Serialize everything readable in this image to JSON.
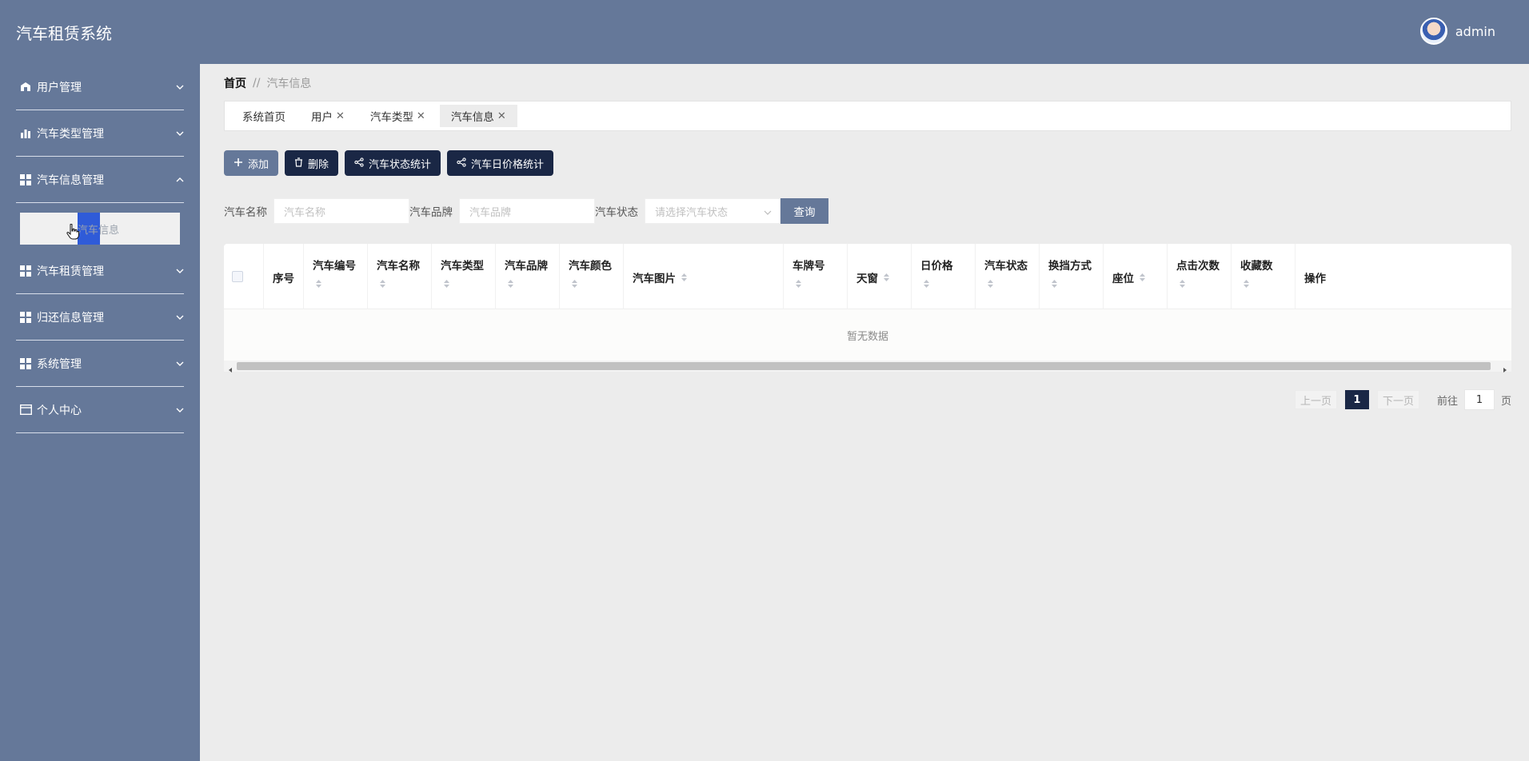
{
  "header": {
    "title": "汽车租赁系统",
    "username": "admin"
  },
  "sidebar": {
    "items": [
      {
        "label": "用户管理",
        "icon": "user-icon",
        "expanded": false
      },
      {
        "label": "汽车类型管理",
        "icon": "bar-chart-icon",
        "expanded": false
      },
      {
        "label": "汽车信息管理",
        "icon": "grid-icon",
        "expanded": true,
        "sub": [
          {
            "label": "汽车信息"
          }
        ]
      },
      {
        "label": "汽车租赁管理",
        "icon": "grid-icon",
        "expanded": false
      },
      {
        "label": "归还信息管理",
        "icon": "grid-icon",
        "expanded": false
      },
      {
        "label": "系统管理",
        "icon": "grid-icon",
        "expanded": false
      },
      {
        "label": "个人中心",
        "icon": "card-icon",
        "expanded": false
      }
    ]
  },
  "breadcrumb": {
    "home": "首页",
    "separator": "//",
    "current": "汽车信息"
  },
  "tabs": [
    {
      "label": "系统首页",
      "closable": false
    },
    {
      "label": "用户",
      "closable": true
    },
    {
      "label": "汽车类型",
      "closable": true
    },
    {
      "label": "汽车信息",
      "closable": true,
      "active": true
    }
  ],
  "actions": {
    "add": "添加",
    "delete": "删除",
    "status_stats": "汽车状态统计",
    "price_stats": "汽车日价格统计"
  },
  "filters": {
    "name_label": "汽车名称",
    "name_placeholder": "汽车名称",
    "brand_label": "汽车品牌",
    "brand_placeholder": "汽车品牌",
    "status_label": "汽车状态",
    "status_placeholder": "请选择汽车状态",
    "query": "查询"
  },
  "table": {
    "columns": [
      "序号",
      "汽车编号",
      "汽车名称",
      "汽车类型",
      "汽车品牌",
      "汽车颜色",
      "汽车图片",
      "车牌号",
      "天窗",
      "日价格",
      "汽车状态",
      "换挡方式",
      "座位",
      "点击次数",
      "收藏数",
      "操作"
    ],
    "empty": "暂无数据"
  },
  "pager": {
    "prev": "上一页",
    "current": "1",
    "next": "下一页",
    "goto": "前往",
    "page_input": "1",
    "page_unit": "页"
  },
  "colors": {
    "primary": "#657899",
    "dark": "#1a2745",
    "highlight": "#2f5bd8"
  }
}
